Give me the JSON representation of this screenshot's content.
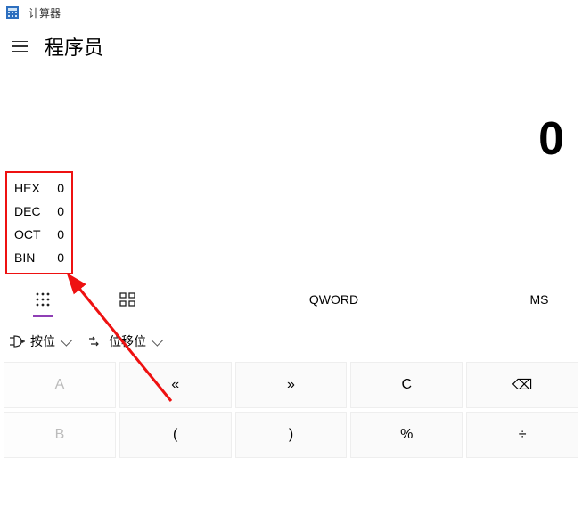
{
  "app": {
    "title": "计算器"
  },
  "header": {
    "mode": "程序员"
  },
  "display": {
    "value": "0"
  },
  "bases": {
    "items": [
      {
        "label": "HEX",
        "value": "0"
      },
      {
        "label": "DEC",
        "value": "0"
      },
      {
        "label": "OCT",
        "value": "0"
      },
      {
        "label": "BIN",
        "value": "0"
      }
    ]
  },
  "toolbar": {
    "word_size": "QWORD",
    "memory_store": "MS"
  },
  "dropdowns": {
    "bitwise": "按位",
    "bitshift": "位移位"
  },
  "keypad": {
    "rows": [
      [
        "A",
        "«",
        "»",
        "C",
        "⌫"
      ],
      [
        "B",
        "(",
        ")",
        "%",
        "÷"
      ]
    ],
    "disabled": [
      "A",
      "B"
    ]
  },
  "annotation": {
    "highlight_box": true,
    "arrow": true,
    "color": "#ee1111"
  }
}
